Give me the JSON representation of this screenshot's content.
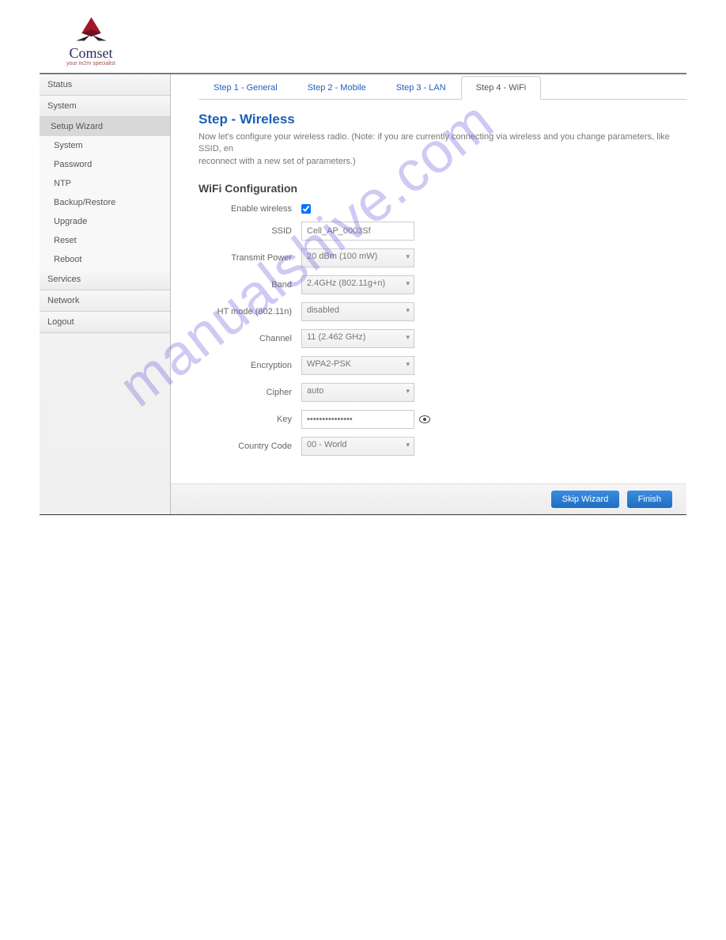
{
  "brand": {
    "name": "Comset",
    "tagline": "your m2m specialist"
  },
  "sidebar": {
    "sections": [
      {
        "label": "Status",
        "items": []
      },
      {
        "label": "System",
        "items": [
          "Setup Wizard",
          "System",
          "Password",
          "NTP",
          "Backup/Restore",
          "Upgrade",
          "Reset",
          "Reboot"
        ]
      },
      {
        "label": "Services",
        "items": []
      },
      {
        "label": "Network",
        "items": []
      },
      {
        "label": "Logout",
        "items": []
      }
    ],
    "active_item": "Setup Wizard"
  },
  "tabs": [
    {
      "label": "Step 1 - General",
      "active": false
    },
    {
      "label": "Step 2 - Mobile",
      "active": false
    },
    {
      "label": "Step 3 - LAN",
      "active": false
    },
    {
      "label": "Step 4 - WiFi",
      "active": true
    }
  ],
  "page": {
    "title": "Step - Wireless",
    "description_line1": "Now let's configure your wireless radio. (Note: if you are currently connecting via wireless and you change parameters, like SSID, en",
    "description_line2": "reconnect with a new set of parameters.)",
    "section_title": "WiFi Configuration"
  },
  "form": {
    "enable_wireless": {
      "label": "Enable wireless",
      "checked": true
    },
    "ssid": {
      "label": "SSID",
      "value": "Cell_AP_0003Sf"
    },
    "transmit_power": {
      "label": "Transmit Power",
      "value": "20 dBm (100 mW)"
    },
    "band": {
      "label": "Band",
      "value": "2.4GHz (802.11g+n)"
    },
    "ht_mode": {
      "label": "HT mode (802.11n)",
      "value": "disabled"
    },
    "channel": {
      "label": "Channel",
      "value": "11 (2.462 GHz)"
    },
    "encryption": {
      "label": "Encryption",
      "value": "WPA2-PSK"
    },
    "cipher": {
      "label": "Cipher",
      "value": "auto"
    },
    "key": {
      "label": "Key",
      "value": "•••••••••••••••"
    },
    "country_code": {
      "label": "Country Code",
      "value": "00 - World"
    }
  },
  "buttons": {
    "skip": "Skip Wizard",
    "finish": "Finish"
  },
  "watermark": "manualshive.com"
}
